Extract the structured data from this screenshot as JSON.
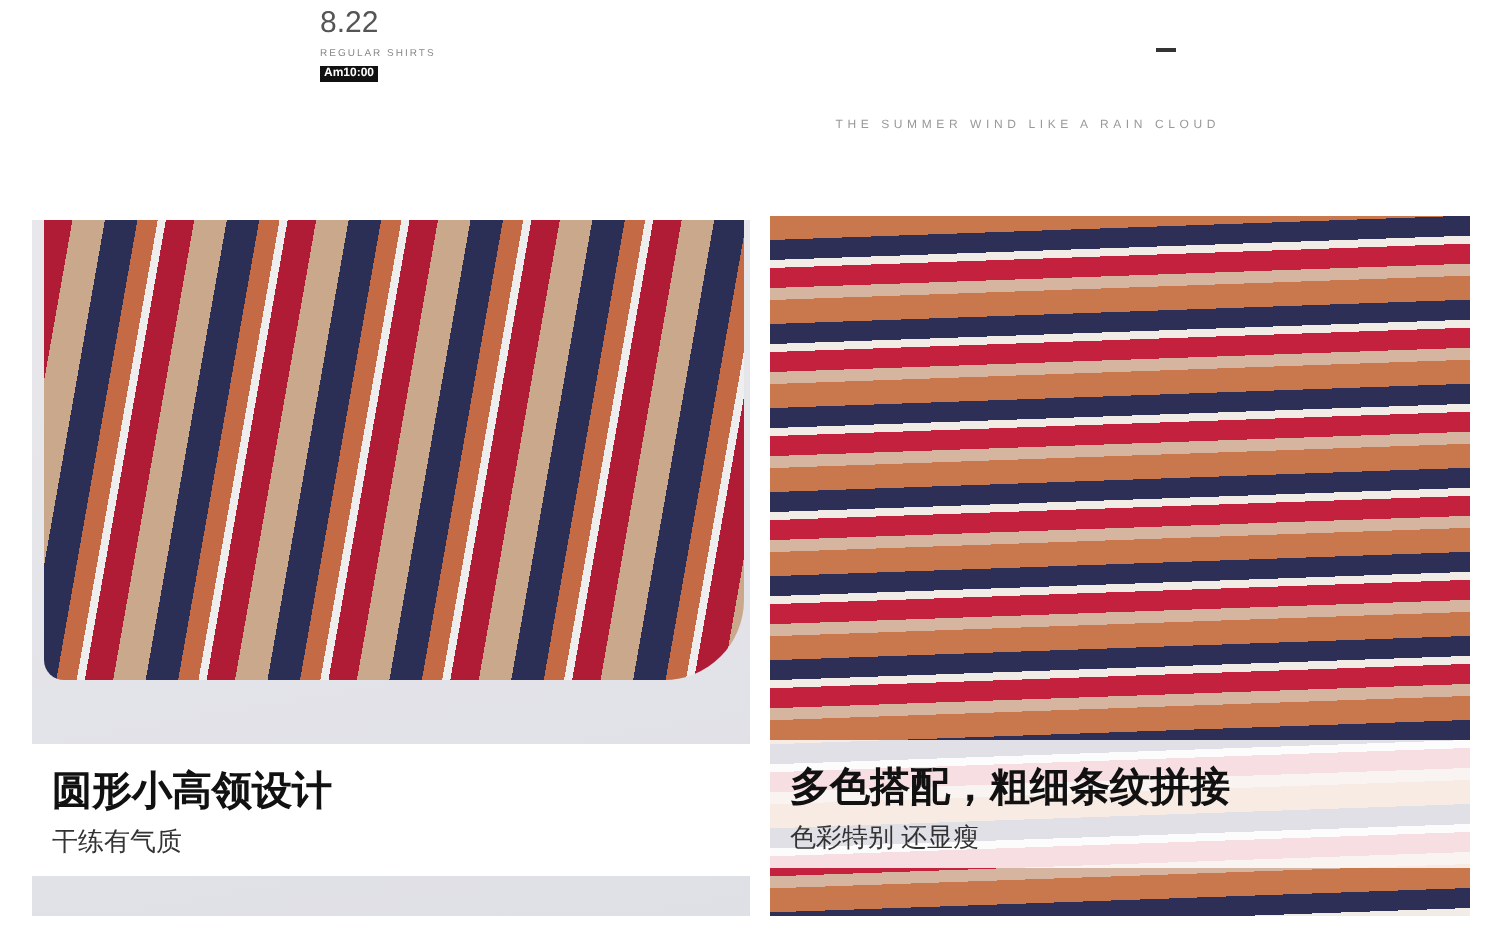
{
  "header": {
    "date": "8.22",
    "subtitle": "REGULAR SHIRTS",
    "time_badge": "Am10:00",
    "tagline": "THE SUMMER WIND LIKE A RAIN CLOUD"
  },
  "panels": [
    {
      "title": "圆形小高领设计",
      "subtitle": "干练有气质"
    },
    {
      "title": "多色搭配，粗细条纹拼接",
      "subtitle": "色彩特别 还显瘦"
    }
  ]
}
